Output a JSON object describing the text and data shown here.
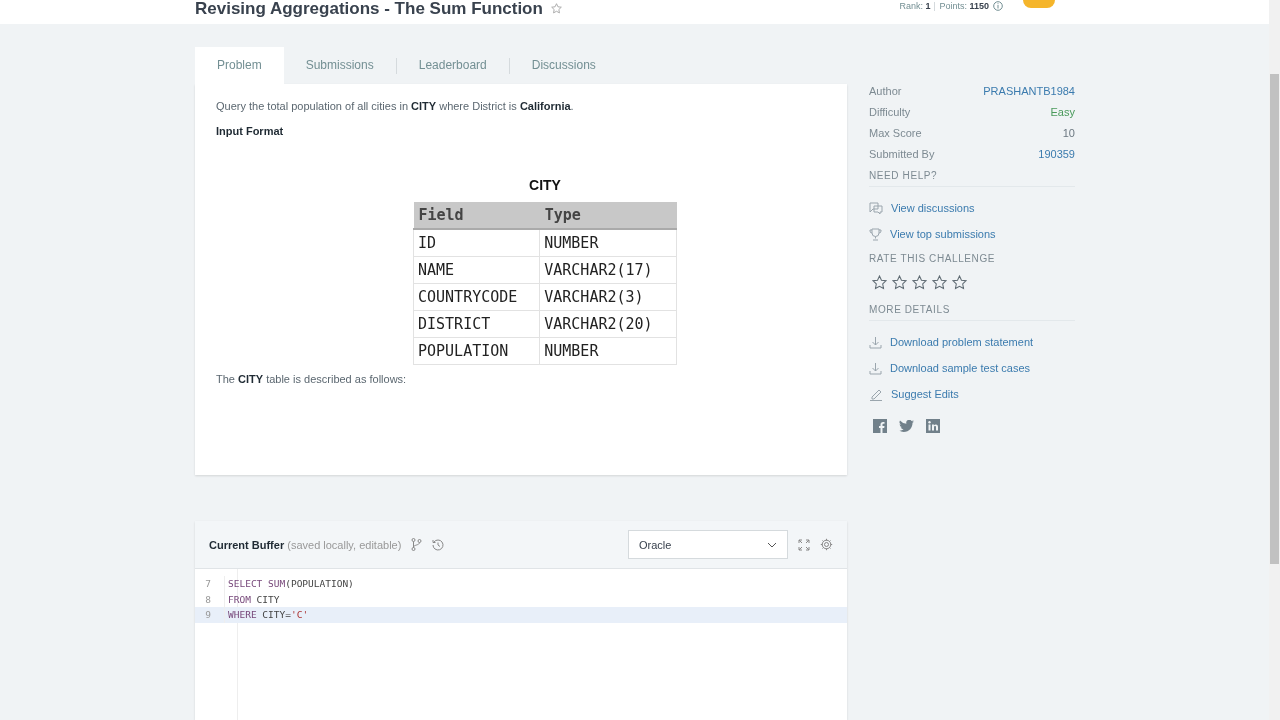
{
  "header": {
    "title": "Revising Aggregations - The Sum Function",
    "rank_label": "Rank:",
    "rank": "1",
    "points_label": "Points:",
    "points": "1150"
  },
  "tabs": [
    {
      "label": "Problem",
      "selected": true
    },
    {
      "label": "Submissions",
      "selected": false
    },
    {
      "label": "Leaderboard",
      "selected": false
    },
    {
      "label": "Discussions",
      "selected": false
    }
  ],
  "problem": {
    "statement": "Query the total population of all cities in **CITY** where District is **California**.",
    "input_heading": "Input Format",
    "table_image": {
      "title": "CITY",
      "columns": [
        "Field",
        "Type"
      ],
      "rows": [
        [
          "ID",
          "NUMBER"
        ],
        [
          "NAME",
          "VARCHAR2(17)"
        ],
        [
          "COUNTRYCODE",
          "VARCHAR2(3)"
        ],
        [
          "DISTRICT",
          "VARCHAR2(20)"
        ],
        [
          "POPULATION",
          "NUMBER"
        ]
      ]
    },
    "description": "The **CITY** table is described as follows:"
  },
  "details": [
    {
      "label": "Author",
      "value": "PRASHANTB1984",
      "kind": "link"
    },
    {
      "label": "Difficulty",
      "value": "Easy",
      "kind": "level"
    },
    {
      "label": "Max Score",
      "value": "10",
      "kind": "plain"
    },
    {
      "label": "Submitted By",
      "value": "190359",
      "kind": "link"
    }
  ],
  "help": {
    "heading": "NEED HELP?",
    "links": [
      {
        "label": "View discussions"
      },
      {
        "label": "View top submissions"
      }
    ]
  },
  "rating": {
    "heading": "RATE THIS CHALLENGE",
    "stars": 0
  },
  "more": {
    "heading": "MORE DETAILS",
    "links": [
      {
        "label": "Download problem statement"
      },
      {
        "label": "Download sample test cases"
      },
      {
        "label": "Suggest Edits"
      }
    ]
  },
  "editor": {
    "title": "Current Buffer",
    "subtitle": "(saved locally, editable)",
    "language": "Oracle",
    "lines": [
      {
        "number": "7",
        "tokens": [
          {
            "text": "SELECT SUM",
            "kind": "keyword"
          },
          {
            "text": "(POPULATION)",
            "kind": "plain"
          }
        ],
        "selected": false
      },
      {
        "number": "8",
        "tokens": [
          {
            "text": "FROM",
            "kind": "keyword"
          },
          {
            "text": " CITY",
            "kind": "plain"
          }
        ],
        "selected": false
      },
      {
        "number": "9",
        "tokens": [
          {
            "text": "WHERE",
            "kind": "keyword"
          },
          {
            "text": " CITY=",
            "kind": "plain"
          },
          {
            "text": "'C'",
            "kind": "string"
          }
        ],
        "selected": true
      }
    ]
  }
}
